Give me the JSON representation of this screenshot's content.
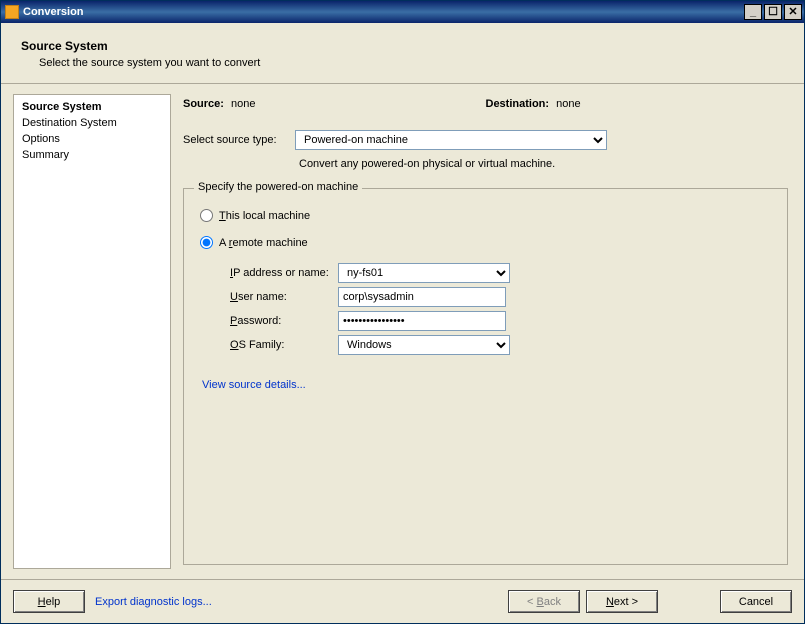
{
  "titlebar": {
    "title": "Conversion"
  },
  "header": {
    "title": "Source System",
    "description": "Select the source system you want to convert"
  },
  "sidebar": {
    "items": [
      {
        "label": "Source System",
        "active": true
      },
      {
        "label": "Destination System",
        "active": false
      },
      {
        "label": "Options",
        "active": false
      },
      {
        "label": "Summary",
        "active": false
      }
    ]
  },
  "status": {
    "source_label": "Source:",
    "source_value": "none",
    "destination_label": "Destination:",
    "destination_value": "none"
  },
  "source_type": {
    "label": "Select source type:",
    "selected": "Powered-on machine",
    "helper": "Convert any powered-on physical or virtual machine."
  },
  "fieldset": {
    "legend": "Specify the powered-on machine",
    "radio_local": "This local machine",
    "radio_local_u": "T",
    "radio_remote": "A remote machine",
    "radio_remote_u": "r",
    "selected_radio": "remote",
    "ip_label": "IP address or name:",
    "ip_label_u": "I",
    "ip_value": "ny-fs01",
    "user_label": "User name:",
    "user_label_u": "U",
    "user_value": "corp\\sysadmin",
    "pass_label": "Password:",
    "pass_label_u": "P",
    "pass_value": "••••••••••••••••",
    "os_label": "OS Family:",
    "os_label_u": "O",
    "os_value": "Windows",
    "view_details": "View source details..."
  },
  "footer": {
    "help": "Help",
    "help_u": "H",
    "export": "Export diagnostic logs...",
    "back": "< Back",
    "back_u": "B",
    "next": "Next >",
    "next_u": "N",
    "cancel": "Cancel"
  }
}
